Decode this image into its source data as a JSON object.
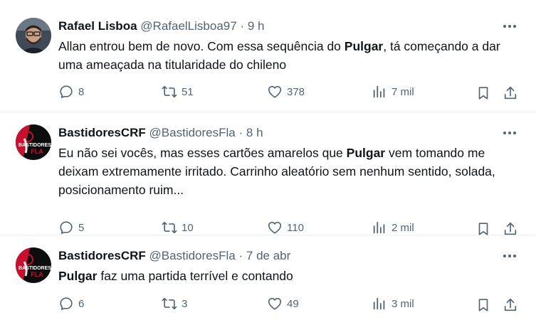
{
  "tweets": [
    {
      "name": "Rafael Lisboa",
      "handle": "@RafaelLisboa97",
      "dot": "·",
      "time": "9 h",
      "text_parts": [
        "Allan entrou bem de novo. Com essa sequência do ",
        "Pulgar",
        ", tá começando a dar uma ameaçada na titularidade do chileno"
      ],
      "replies": "8",
      "retweets": "51",
      "likes": "378",
      "views": "7 mil"
    },
    {
      "name": "BastidoresCRF",
      "handle": "@BastidoresFla",
      "dot": "·",
      "time": "8 h",
      "text_parts": [
        "Eu não sei vocês, mas esses cartões amarelos que ",
        "Pulgar",
        " vem tomando me deixam extremamente irritado. Carrinho aleatório sem nenhum sentido, solada, posicionamento ruim..."
      ],
      "replies": "5",
      "retweets": "10",
      "likes": "110",
      "views": "2 mil"
    },
    {
      "name": "BastidoresCRF",
      "handle": "@BastidoresFla",
      "dot": "·",
      "time": "7 de abr",
      "text_parts": [
        "",
        "Pulgar",
        " faz uma partida terrível e contando"
      ],
      "replies": "6",
      "retweets": "3",
      "likes": "49",
      "views": "3 mil"
    }
  ],
  "avatar_logo_text": "BASTIDORES FLA",
  "colors": {
    "text": "#0f1419",
    "secondary": "#536471",
    "divider": "#eff3f4",
    "flamengo_red": "#c8102e"
  }
}
